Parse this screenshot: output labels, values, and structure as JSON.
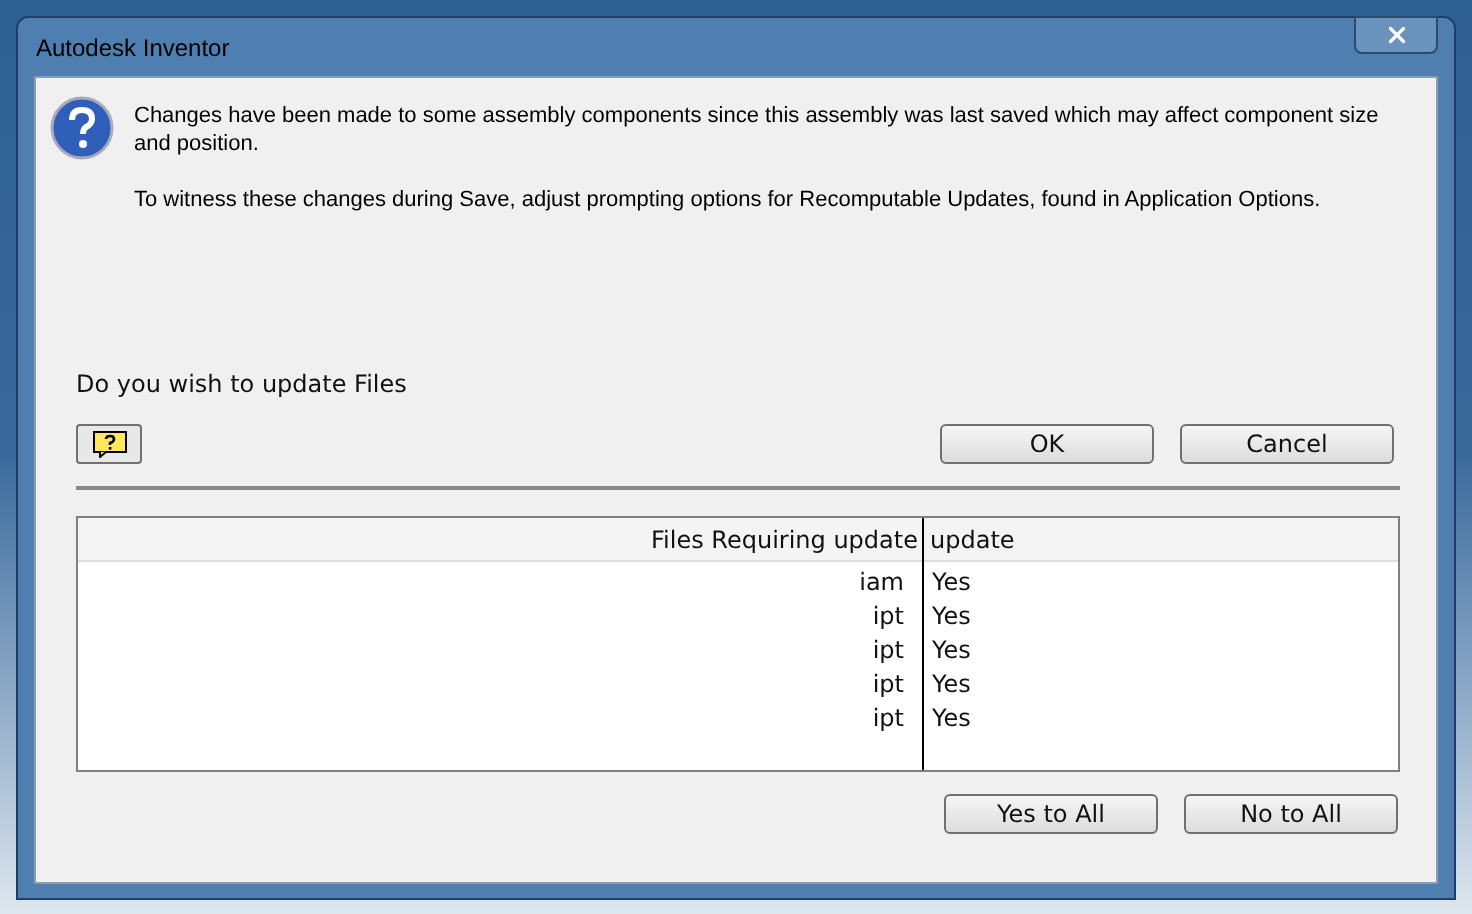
{
  "window": {
    "title": "Autodesk Inventor"
  },
  "message": {
    "text": "Changes have been made to some assembly components since this assembly was last saved which may affect component size and position.",
    "note": "To witness these changes during Save, adjust prompting options for Recomputable Updates, found in Application Options."
  },
  "prompt": "Do you wish to update Files",
  "top_buttons": [
    "OK",
    "Cancel"
  ],
  "table": {
    "columns": [
      "Files Requiring update",
      "update"
    ],
    "rows": [
      {
        "file": "iam",
        "update": "Yes"
      },
      {
        "file": "ipt",
        "update": "Yes"
      },
      {
        "file": "ipt",
        "update": "Yes"
      },
      {
        "file": "ipt",
        "update": "Yes"
      },
      {
        "file": "ipt",
        "update": "Yes"
      }
    ]
  },
  "bottom_buttons": [
    "Yes to All",
    "No to All"
  ]
}
